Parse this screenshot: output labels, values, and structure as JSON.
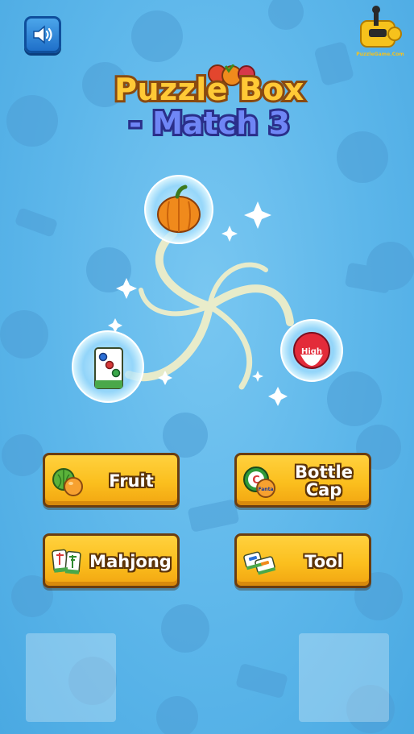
{
  "title": {
    "line1": "Puzzle Box",
    "line2": "- Match 3"
  },
  "brand": {
    "name": "PuzzleGame.Com",
    "icon": "puzzle-joystick-icon"
  },
  "sound": {
    "icon": "speaker-icon"
  },
  "center": {
    "pumpkin": "pumpkin-icon",
    "mahjong": "mahjong-tile-icon",
    "bottlecap": {
      "icon": "bottle-cap-icon",
      "text": "High"
    }
  },
  "modes": [
    {
      "label": "Fruit",
      "icon": "fruit-icon"
    },
    {
      "label_line1": "Bottle",
      "label_line2": "Cap",
      "icon": "bottle-cap-icon",
      "cap_text": "Fanta"
    },
    {
      "label": "Mahjong",
      "icon": "mahjong-tiles-icon"
    },
    {
      "label": "Tool",
      "icon": "tool-tiles-icon"
    }
  ],
  "colors": {
    "background": "#5cb6ea",
    "button": "#fbbf1e",
    "button_border": "#6a3d10",
    "title_yellow": "#ffc936",
    "title_blue": "#4a6cf0"
  }
}
